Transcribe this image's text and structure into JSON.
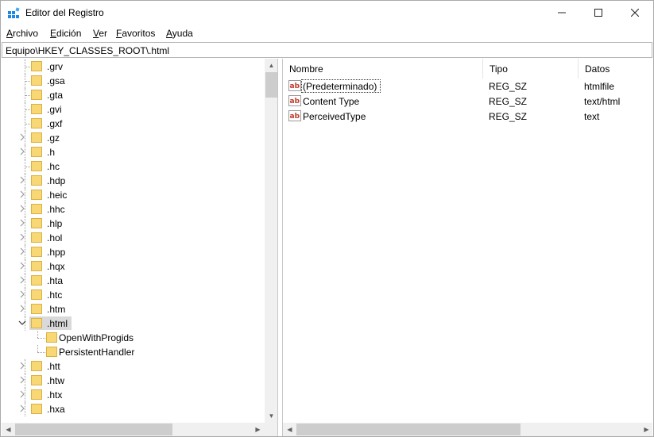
{
  "window": {
    "title": "Editor del Registro"
  },
  "titlebar_buttons": {
    "minimize": "—",
    "maximize": "☐",
    "close": "✕"
  },
  "menu": [
    {
      "label": "Archivo",
      "accel": "A",
      "rest": "rchivo"
    },
    {
      "label": "Edición",
      "accel": "E",
      "rest": "dición"
    },
    {
      "label": "Ver",
      "accel": "V",
      "rest": "er"
    },
    {
      "label": "Favoritos",
      "accel": "F",
      "rest": "avoritos"
    },
    {
      "label": "Ayuda",
      "accel": "A",
      "rest": "yuda"
    }
  ],
  "address": {
    "path": "Equipo\\HKEY_CLASSES_ROOT\\.html"
  },
  "tree": {
    "items": [
      {
        "label": ".grv",
        "expandable": false
      },
      {
        "label": ".gsa",
        "expandable": false
      },
      {
        "label": ".gta",
        "expandable": false
      },
      {
        "label": ".gvi",
        "expandable": false
      },
      {
        "label": ".gxf",
        "expandable": false
      },
      {
        "label": ".gz",
        "expandable": true
      },
      {
        "label": ".h",
        "expandable": true
      },
      {
        "label": ".hc",
        "expandable": false
      },
      {
        "label": ".hdp",
        "expandable": true
      },
      {
        "label": ".heic",
        "expandable": true
      },
      {
        "label": ".hhc",
        "expandable": true
      },
      {
        "label": ".hlp",
        "expandable": true
      },
      {
        "label": ".hol",
        "expandable": true
      },
      {
        "label": ".hpp",
        "expandable": true
      },
      {
        "label": ".hqx",
        "expandable": true
      },
      {
        "label": ".hta",
        "expandable": true
      },
      {
        "label": ".htc",
        "expandable": true
      },
      {
        "label": ".htm",
        "expandable": true
      },
      {
        "label": ".html",
        "expandable": true,
        "expanded": true,
        "selected": true
      },
      {
        "label": "OpenWithProgids",
        "child": true
      },
      {
        "label": "PersistentHandler",
        "child": true
      },
      {
        "label": ".htt",
        "expandable": true
      },
      {
        "label": ".htw",
        "expandable": true
      },
      {
        "label": ".htx",
        "expandable": true
      },
      {
        "label": ".hxa",
        "expandable": true
      }
    ]
  },
  "list": {
    "columns": [
      "Nombre",
      "Tipo",
      "Datos"
    ],
    "rows": [
      {
        "name": "(Predeterminado)",
        "type": "REG_SZ",
        "data": "htmlfile"
      },
      {
        "name": "Content Type",
        "type": "REG_SZ",
        "data": "text/html"
      },
      {
        "name": "PerceivedType",
        "type": "REG_SZ",
        "data": "text"
      }
    ]
  },
  "colors": {
    "folder": "#f8d775",
    "folder_edge": "#dcb040",
    "ab_red": "#c0392b",
    "selected": "#d9d9d9"
  },
  "icons": {
    "app": "registry-editor-icon",
    "folder": "folder-icon",
    "value": "string-value-icon",
    "chevron_right": "chevron-right-icon",
    "chevron_down": "chevron-down-icon"
  }
}
